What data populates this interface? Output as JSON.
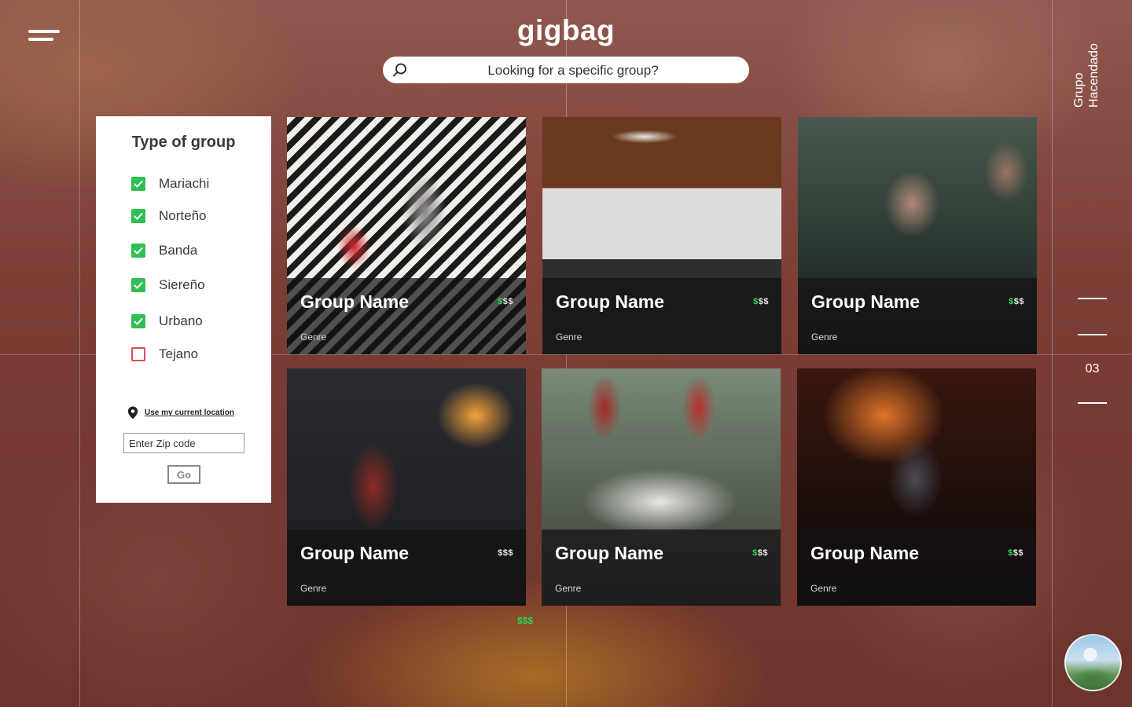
{
  "app": {
    "logo": "gigbag",
    "search_placeholder": "Looking for a specific group?"
  },
  "filter": {
    "title": "Type of group",
    "options": [
      {
        "label": "Mariachi",
        "checked": true
      },
      {
        "label": "Norteño",
        "checked": true
      },
      {
        "label": "Banda",
        "checked": true
      },
      {
        "label": "Siereño",
        "checked": true
      },
      {
        "label": "Urbano",
        "checked": true
      },
      {
        "label": "Tejano",
        "checked": false
      }
    ],
    "location_link": "Use my current location",
    "zip_placeholder": "Enter Zip code",
    "go_label": "Go"
  },
  "cards": [
    {
      "name": "Group Name",
      "genre": "Genre",
      "price_active": "$",
      "price_inactive": "$$"
    },
    {
      "name": "Group Name",
      "genre": "Genre",
      "price_active": "$",
      "price_inactive": "$$"
    },
    {
      "name": "Group Name",
      "genre": "Genre",
      "price_active": "$",
      "price_inactive": "$$"
    },
    {
      "name": "Group Name",
      "genre": "Genre",
      "price_active": "",
      "price_inactive": "$$$"
    },
    {
      "name": "Group Name",
      "genre": "Genre",
      "price_active": "$",
      "price_inactive": "$$"
    },
    {
      "name": "Group Name",
      "genre": "Genre",
      "price_active": "$",
      "price_inactive": "$$"
    }
  ],
  "stray_price": "$$$",
  "side": {
    "title_line1": "Grupo",
    "title_line2": "Hacendado",
    "page_number": "03"
  },
  "colors": {
    "accent_green": "#2fbf55",
    "unchecked_border": "#e0485a"
  }
}
